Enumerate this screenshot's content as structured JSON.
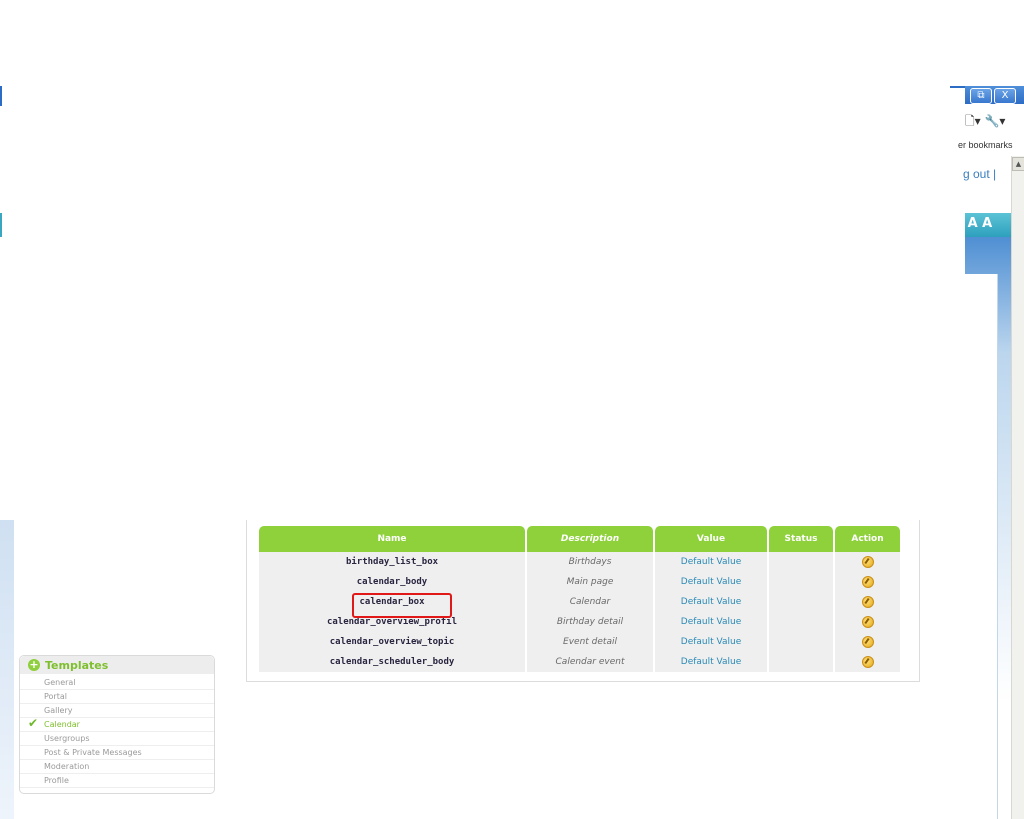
{
  "background": {
    "win_restore_icon": "restore-icon",
    "win_close_label": "X",
    "toolbar_glyphs": "🗋▾ 🔧▾",
    "bookmarks_text": "er bookmarks",
    "logout_text": "g out |"
  },
  "sidebar": {
    "title": "Templates",
    "items": [
      {
        "label": "General",
        "active": false
      },
      {
        "label": "Portal",
        "active": false
      },
      {
        "label": "Gallery",
        "active": false
      },
      {
        "label": "Calendar",
        "active": true
      },
      {
        "label": "Usergroups",
        "active": false
      },
      {
        "label": "Post & Private Messages",
        "active": false
      },
      {
        "label": "Moderation",
        "active": false
      },
      {
        "label": "Profile",
        "active": false
      }
    ]
  },
  "table": {
    "headers": {
      "name": "Name",
      "description": "Description",
      "value": "Value",
      "status": "Status",
      "action": "Action"
    },
    "rows": [
      {
        "name": "birthday_list_box",
        "description": "Birthdays",
        "value": "Default Value",
        "status": ""
      },
      {
        "name": "calendar_body",
        "description": "Main page",
        "value": "Default Value",
        "status": ""
      },
      {
        "name": "calendar_box",
        "description": "Calendar",
        "value": "Default Value",
        "status": ""
      },
      {
        "name": "calendar_overview_profil",
        "description": "Birthday detail",
        "value": "Default Value",
        "status": ""
      },
      {
        "name": "calendar_overview_topic",
        "description": "Event detail",
        "value": "Default Value",
        "status": ""
      },
      {
        "name": "calendar_scheduler_body",
        "description": "Calendar event",
        "value": "Default Value",
        "status": ""
      }
    ]
  },
  "colors": {
    "header_green": "#8ed13b",
    "title_green": "#7fbf2e",
    "value_blue": "#2a8ab5",
    "highlight_red": "#e01818"
  }
}
